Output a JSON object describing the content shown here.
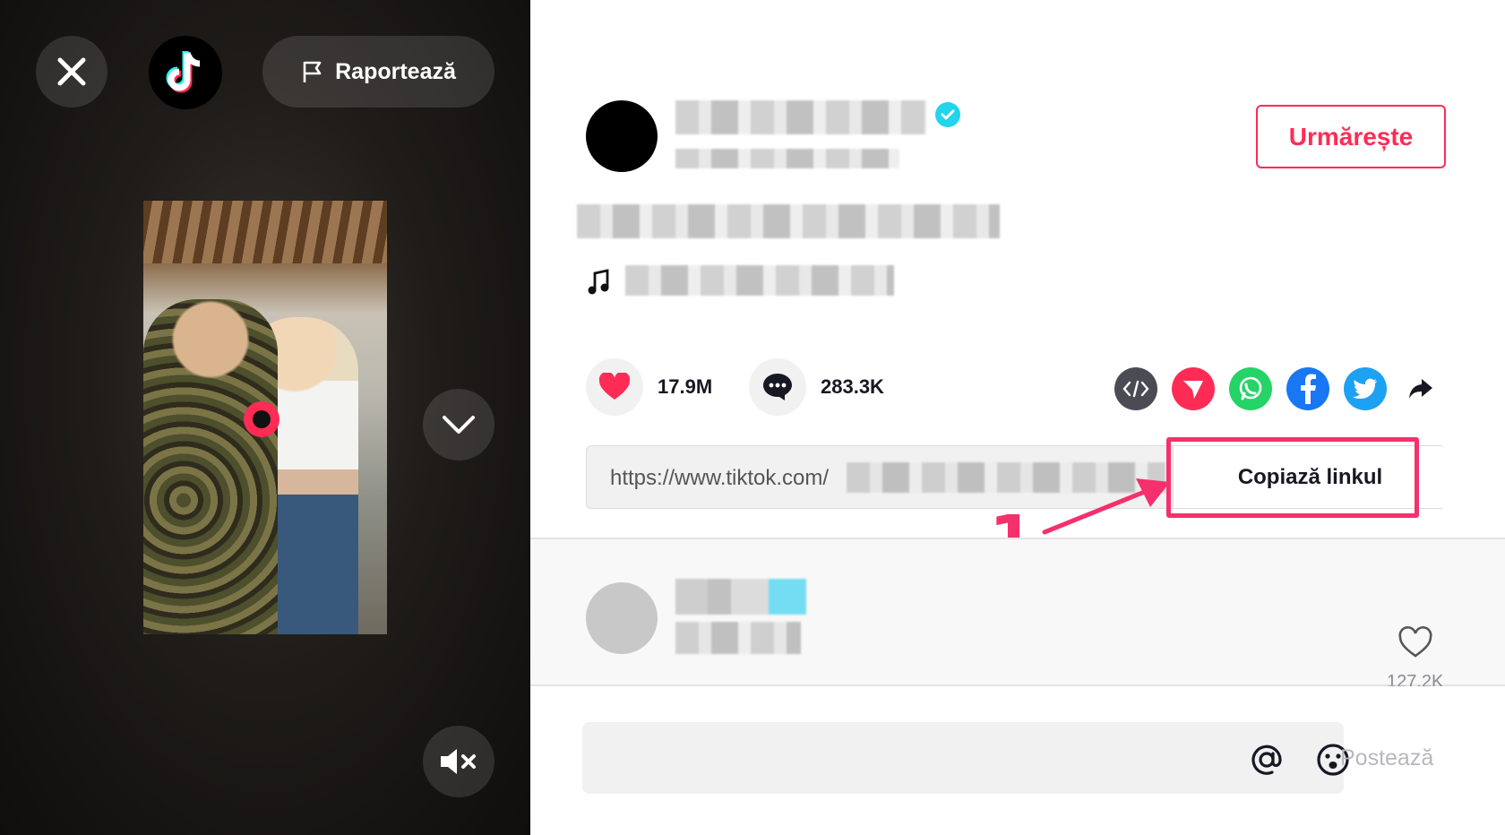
{
  "left_panel": {
    "report_label": "Raportează",
    "icons": {
      "close": "close-icon",
      "logo": "tiktok-logo",
      "flag": "flag-icon",
      "down": "chevron-down-icon",
      "mute": "mute-icon"
    }
  },
  "post": {
    "follow_label": "Urmărește",
    "likes": "17.9M",
    "comments": "283.3K",
    "share_icons": [
      "embed-icon",
      "send-icon",
      "whatsapp-icon",
      "facebook-icon",
      "twitter-icon",
      "share-arrow-icon"
    ],
    "link_prefix": "https://www.tiktok.com/",
    "copy_label": "Copiază linkul"
  },
  "annotation": {
    "number": "1",
    "color": "#f5306c"
  },
  "comment": {
    "likes": "127.2K"
  },
  "composer": {
    "post_label": "Postează"
  },
  "colors": {
    "accent": "#fe2c55",
    "verified": "#20d5ec",
    "whatsapp": "#25d366",
    "facebook": "#1877f2",
    "twitter": "#1da1f2"
  }
}
